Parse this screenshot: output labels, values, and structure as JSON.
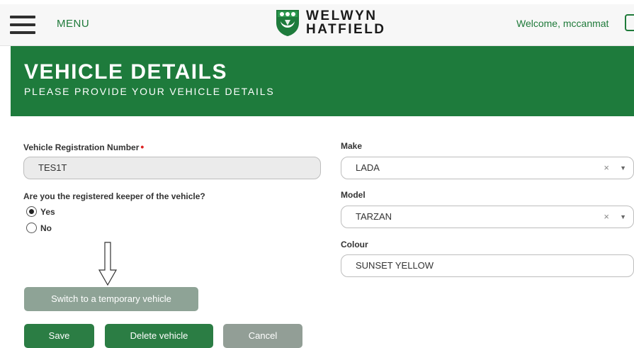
{
  "header": {
    "menu_label": "MENU",
    "logo_line1": "WELWYN",
    "logo_line2": "HATFIELD",
    "welcome_text": "Welcome, mccanmat",
    "menu_icon": "hamburger-icon",
    "logo_icon": "crest-icon"
  },
  "banner": {
    "title": "VEHICLE DETAILS",
    "subtitle": "PLEASE PROVIDE YOUR VEHICLE DETAILS"
  },
  "form": {
    "registration": {
      "label": "Vehicle Registration Number",
      "required_marker": "•",
      "value": "TES1T"
    },
    "keeper": {
      "question": "Are you the registered keeper of the vehicle?",
      "options": [
        "Yes",
        "No"
      ],
      "selected": "Yes"
    },
    "make": {
      "label": "Make",
      "value": "LADA",
      "clear": "×",
      "caret": "▼"
    },
    "model": {
      "label": "Model",
      "value": "TARZAN",
      "clear": "×",
      "caret": "▼"
    },
    "colour": {
      "label": "Colour",
      "value": "SUNSET YELLOW"
    }
  },
  "buttons": {
    "switch_temp": "Switch to a temporary vehicle",
    "save": "Save",
    "delete": "Delete vehicle",
    "cancel": "Cancel"
  },
  "colors": {
    "brand_green": "#1e7b3c",
    "button_green": "#2b7d44",
    "button_gray": "#8ea396"
  }
}
